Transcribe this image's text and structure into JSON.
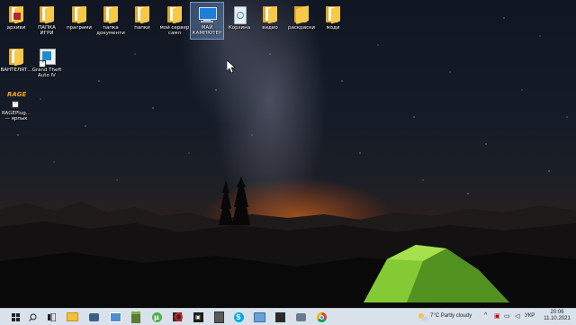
{
  "desktop": {
    "icons": [
      {
        "label": "архиви",
        "icon": "folder-with-app-icon"
      },
      {
        "label": "ПАПКА ИГРИ",
        "icon": "folder-icon"
      },
      {
        "label": "праграми",
        "icon": "folder-icon"
      },
      {
        "label": "папка документи",
        "icon": "folder-icon"
      },
      {
        "label": "папки",
        "icon": "folder-icon"
      },
      {
        "label": "мой сервер самп",
        "icon": "folder-icon"
      },
      {
        "label": "МАЙ КАМПЮТЕР",
        "icon": "computer-icon"
      },
      {
        "label": "Корзина",
        "icon": "recycle-bin-icon"
      },
      {
        "label": "видио",
        "icon": "folder-icon"
      },
      {
        "label": "раскраски",
        "icon": "folder-icon"
      },
      {
        "label": "моди",
        "icon": "folder-icon"
      },
      {
        "label": "ВАНТЕЛЯТ...",
        "icon": "folder-icon"
      },
      {
        "label": "Grand Theft Auto IV",
        "icon": "gta-shortcut-icon"
      },
      {
        "label": "RAGEPlug... — ярлык",
        "icon": "rage-shortcut-icon"
      }
    ],
    "rage_logo_text": "RAGE"
  },
  "taskbar": {
    "items": [
      {
        "name": "start-button",
        "glyph": "⊞"
      },
      {
        "name": "search-icon",
        "glyph": "⌕"
      },
      {
        "name": "task-view-icon",
        "glyph": "❐"
      },
      {
        "name": "file-explorer-icon",
        "glyph": "▭"
      },
      {
        "name": "camera-app-icon",
        "glyph": "◉"
      },
      {
        "name": "photos-app-icon",
        "glyph": "▦"
      },
      {
        "name": "minecraft-icon",
        "glyph": "■"
      },
      {
        "name": "utorrent-icon",
        "glyph": "µ"
      },
      {
        "name": "app-icon",
        "glyph": "▣"
      },
      {
        "name": "opera-icon",
        "glyph": "O"
      },
      {
        "name": "media-app-icon",
        "glyph": "▣"
      },
      {
        "name": "calculator-icon",
        "glyph": "▤"
      },
      {
        "name": "skype-icon",
        "glyph": "S"
      },
      {
        "name": "notes-app-icon",
        "glyph": "▧"
      },
      {
        "name": "terminal-app-icon",
        "glyph": "▪"
      },
      {
        "name": "camera-icon",
        "glyph": "◎"
      },
      {
        "name": "chrome-icon",
        "glyph": "◍"
      }
    ],
    "weather": {
      "temp": "7°C",
      "condition": "Partly cloudy"
    },
    "language": "УКР",
    "time": "20:06",
    "date": "11.10.2021"
  },
  "colors": {
    "taskbar_bg": "#d9e1ea",
    "folder": "#f7c948",
    "tent": "#8cd13a"
  }
}
